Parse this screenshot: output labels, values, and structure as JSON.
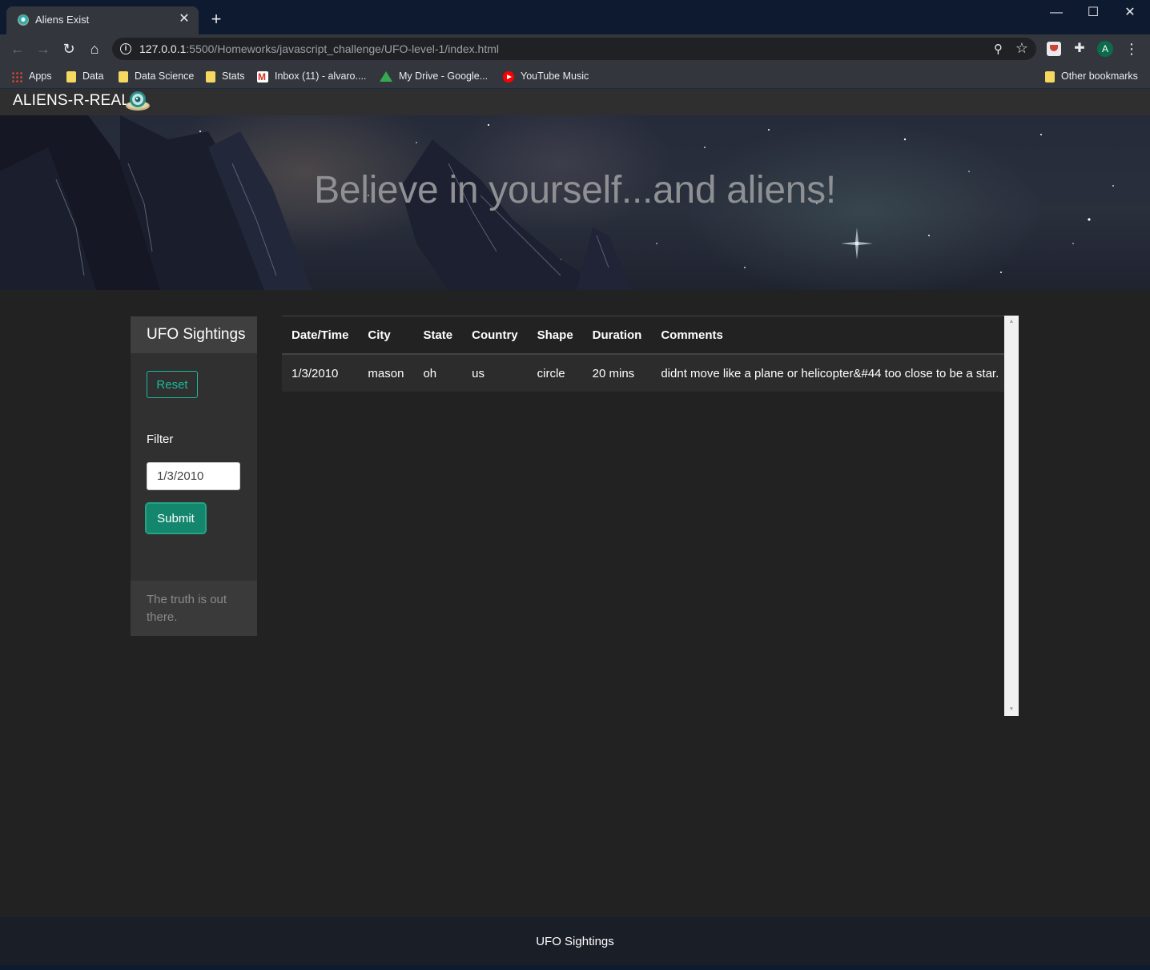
{
  "browser": {
    "tab_title": "Aliens Exist",
    "tab_close": "✕",
    "new_tab": "+",
    "window": {
      "minimize": "—",
      "maximize": "☐",
      "close": "✕"
    },
    "url_host": "127.0.0.1",
    "url_rest": ":5500/Homeworks/javascript_challenge/UFO-level-1/index.html",
    "bookmarks": [
      "Apps",
      "Data",
      "Data Science",
      "Stats",
      "Inbox (11) - alvaro....",
      "My Drive - Google...",
      "YouTube Music"
    ],
    "other_bookmarks": "Other bookmarks",
    "profile_initial": "A"
  },
  "navbar": {
    "brand": "ALIENS-R-REAL"
  },
  "hero": {
    "title": "Believe in yourself...and aliens!"
  },
  "sidebar": {
    "title": "UFO Sightings",
    "reset_label": "Reset",
    "filter_label": "Filter",
    "filter_value": "1/3/2010",
    "submit_label": "Submit",
    "footer_text": "The truth is out there."
  },
  "table": {
    "columns": [
      "Date/Time",
      "City",
      "State",
      "Country",
      "Shape",
      "Duration",
      "Comments"
    ],
    "rows": [
      [
        "1/3/2010",
        "mason",
        "oh",
        "us",
        "circle",
        "20 mins",
        "didnt move like a plane or helicopter&#44 too close to be a star."
      ]
    ]
  },
  "footer": {
    "text": "UFO Sightings"
  },
  "colors": {
    "accent": "#18bc9c",
    "submit_bg": "#13866d",
    "page_bg": "#222222"
  }
}
